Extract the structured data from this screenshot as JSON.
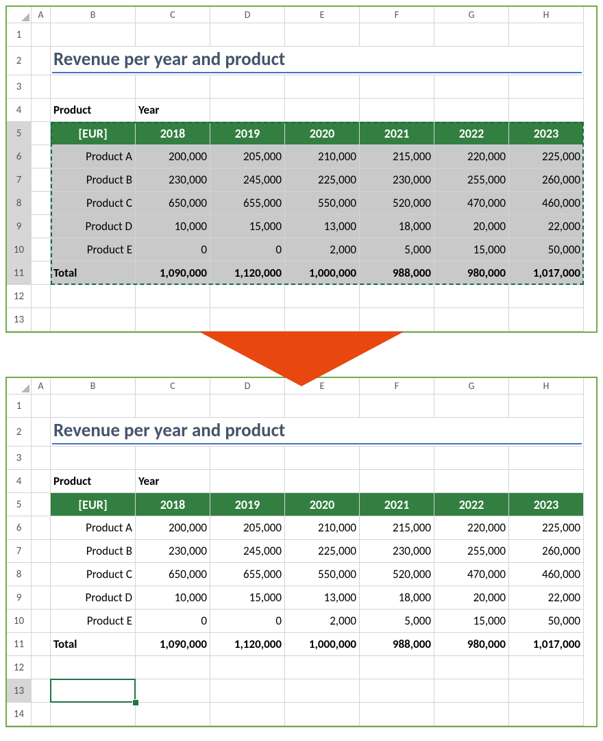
{
  "cols": [
    "A",
    "B",
    "C",
    "D",
    "E",
    "F",
    "G",
    "H"
  ],
  "rows_top": [
    "1",
    "2",
    "3",
    "4",
    "5",
    "6",
    "7",
    "8",
    "9",
    "10",
    "11",
    "12",
    "13"
  ],
  "rows_bot": [
    "1",
    "2",
    "3",
    "4",
    "5",
    "6",
    "7",
    "8",
    "9",
    "10",
    "11",
    "12",
    "13",
    "14"
  ],
  "title": "Revenue per year and product",
  "label_product": "Product",
  "label_year": "Year",
  "header_eur": "[EUR]",
  "years": [
    "2018",
    "2019",
    "2020",
    "2021",
    "2022",
    "2023"
  ],
  "data": [
    {
      "p": "Product A",
      "v": [
        "200,000",
        "205,000",
        "210,000",
        "215,000",
        "220,000",
        "225,000"
      ]
    },
    {
      "p": "Product B",
      "v": [
        "230,000",
        "245,000",
        "225,000",
        "230,000",
        "255,000",
        "260,000"
      ]
    },
    {
      "p": "Product C",
      "v": [
        "650,000",
        "655,000",
        "550,000",
        "520,000",
        "470,000",
        "460,000"
      ]
    },
    {
      "p": "Product D",
      "v": [
        "10,000",
        "15,000",
        "13,000",
        "18,000",
        "20,000",
        "22,000"
      ]
    },
    {
      "p": "Product E",
      "v": [
        "0",
        "0",
        "2,000",
        "5,000",
        "15,000",
        "50,000"
      ]
    }
  ],
  "total_label": "Total",
  "totals": [
    "1,090,000",
    "1,120,000",
    "1,000,000",
    "988,000",
    "980,000",
    "1,017,000"
  ]
}
